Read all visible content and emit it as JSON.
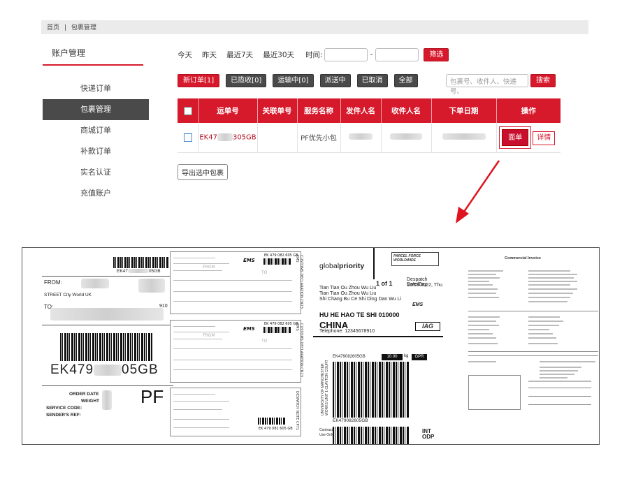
{
  "breadcrumb": {
    "home": "首页",
    "separator": "|",
    "current": "包裹管理"
  },
  "sidebar": {
    "title": "账户管理",
    "items": [
      {
        "label": "快递订单",
        "active": false
      },
      {
        "label": "包裹管理",
        "active": true
      },
      {
        "label": "商城订单",
        "active": false
      },
      {
        "label": "补款订单",
        "active": false
      },
      {
        "label": "实名认证",
        "active": false
      },
      {
        "label": "充值账户",
        "active": false
      }
    ]
  },
  "filters": {
    "today": "今天",
    "yesterday": "昨天",
    "last7": "最近7天",
    "last30": "最近30天",
    "time_label": "时间:",
    "dash": "-",
    "filter_button": "筛选"
  },
  "status_tabs": {
    "new": "新订单[1]",
    "collected": "已揽收[0]",
    "in_transit": "运输中[0]",
    "delivering": "派送中",
    "cancelled": "已取消",
    "all": "全部"
  },
  "search": {
    "placeholder": "包裹号、收件人、快递号、",
    "button": "搜索"
  },
  "table": {
    "headers": [
      "运单号",
      "关联单号",
      "服务名称",
      "发件人名",
      "收件人名",
      "下单日期",
      "操作"
    ],
    "rows": [
      {
        "tracking_prefix": "EK47",
        "tracking_suffix": "305GB",
        "related": "",
        "service": "PF优先小包",
        "face_button": "面单",
        "detail_button": "详情"
      }
    ]
  },
  "export_button": "导出选中包裹",
  "colors": {
    "accent": "#d7192c",
    "sidebar_active": "#4a4a4a",
    "breadcrumb_bg": "#ebebeb"
  },
  "labels_preview": {
    "label1": {
      "top_code": "EK47",
      "top_code_end": "05GB",
      "from": "FROM:",
      "street": "STREET City World UK",
      "to": "TO:",
      "to_number": "910",
      "tracking_prefix": "EK479",
      "tracking_suffix": "05GB",
      "order_date": "ORDER DATE",
      "weight": "WEIGHT",
      "service_code": "SERVICE CODE:",
      "sender_ref": "SENDER'S REF:",
      "service_mark": "PF"
    },
    "label2": {
      "from": "FROM",
      "to": "TO",
      "ems": "EMS",
      "tracking": "EK 479 082 605 GB",
      "side_text": "CUSTOMS DECLARATION CN23 EMS",
      "side_text_2": "DESPATCH NOTE CP71"
    },
    "label3": {
      "brand": "global",
      "brand_bold": "priority",
      "parcelforce": "PARCEL FORCE WORLDWIDE",
      "page": "1 of 1",
      "despatch": "Despatch Date/Day",
      "date": "10/03/2022, Thu",
      "addr1": "Tian Tian Ou Zhou Wu Liu",
      "addr2": "Tian Tian Ou Zhou Wu Liu",
      "addr3": "Shi Chang Bu Ce Shi Ding Dan Wu Li",
      "ems": "EMS",
      "city": "HU HE HAO TE SHI 010000",
      "country": "CHINA",
      "telephone": "Telephone: 12345678910",
      "iag": "IAG",
      "tracking": "EK479082605GB",
      "weight": "10.00",
      "kg": "kg",
      "gpr": "GPR",
      "sender_side": "UNIVERSITY OF MANCHESTER WORKS UNIT 1 CLAYTON COURT",
      "tracking_bottom": "EK479082605GB",
      "int": "INT",
      "odp": "ODP",
      "contract": "Contract",
      "use_only": "Use Only"
    },
    "label4": {
      "title": "Commercial Invoice"
    }
  }
}
